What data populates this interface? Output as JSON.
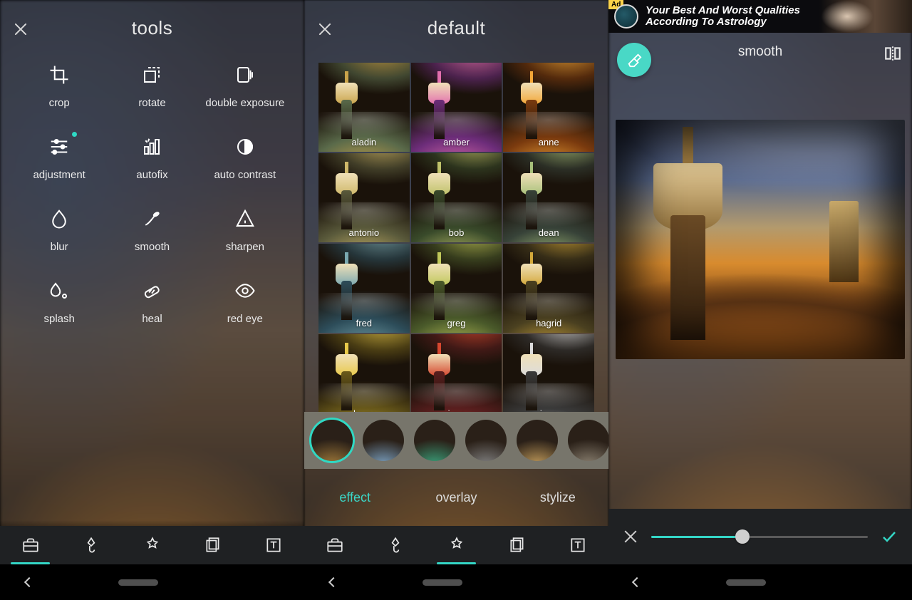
{
  "pane1": {
    "title": "tools",
    "tools": [
      {
        "label": "crop",
        "icon": "crop-icon",
        "dot": false
      },
      {
        "label": "rotate",
        "icon": "rotate-icon",
        "dot": false
      },
      {
        "label": "double exposure",
        "icon": "double-exposure-icon",
        "dot": false
      },
      {
        "label": "adjustment",
        "icon": "adjustment-icon",
        "dot": true
      },
      {
        "label": "autofix",
        "icon": "autofix-icon",
        "dot": false
      },
      {
        "label": "auto contrast",
        "icon": "auto-contrast-icon",
        "dot": false
      },
      {
        "label": "blur",
        "icon": "blur-icon",
        "dot": false
      },
      {
        "label": "smooth",
        "icon": "smooth-icon",
        "dot": false
      },
      {
        "label": "sharpen",
        "icon": "sharpen-icon",
        "dot": false
      },
      {
        "label": "splash",
        "icon": "splash-icon",
        "dot": false
      },
      {
        "label": "heal",
        "icon": "heal-icon",
        "dot": false
      },
      {
        "label": "red eye",
        "icon": "red-eye-icon",
        "dot": false
      }
    ],
    "bottom_tabs": [
      {
        "icon": "toolbox-icon",
        "active": true
      },
      {
        "icon": "brush-icon",
        "active": false
      },
      {
        "icon": "effects-icon",
        "active": false
      },
      {
        "icon": "layers-icon",
        "active": false
      },
      {
        "icon": "text-icon",
        "active": false
      }
    ]
  },
  "pane2": {
    "title": "default",
    "filters": [
      "aladin",
      "amber",
      "anne",
      "antonio",
      "bob",
      "dean",
      "fred",
      "greg",
      "hagrid",
      "harry",
      "ivan",
      "jean"
    ],
    "filter_tints": [
      {
        "a": "#5a6a4a",
        "b": "#c9a34a"
      },
      {
        "a": "#6d2d7a",
        "b": "#e36fae"
      },
      {
        "a": "#7a3a0e",
        "b": "#f3a637"
      },
      {
        "a": "#5a5a3b",
        "b": "#cfb86a"
      },
      {
        "a": "#394a2a",
        "b": "#bfc26a"
      },
      {
        "a": "#374238",
        "b": "#a7c07a"
      },
      {
        "a": "#2d4d5a",
        "b": "#7aa8b0"
      },
      {
        "a": "#4a5a2a",
        "b": "#c0c85a"
      },
      {
        "a": "#4a4020",
        "b": "#d3a83a"
      },
      {
        "a": "#6a5a1a",
        "b": "#e8c94a"
      },
      {
        "a": "#5a1e1e",
        "b": "#d5472f"
      },
      {
        "a": "#3a3a3a",
        "b": "#dcdcdc"
      }
    ],
    "category_tints": [
      "#a07a3a",
      "#7aa0c0",
      "#3aa07a",
      "#808080",
      "#c09a5a",
      "#8a8070",
      "#d040a0"
    ],
    "category_selected": 0,
    "modes": [
      {
        "label": "effect",
        "selected": true
      },
      {
        "label": "overlay",
        "selected": false
      },
      {
        "label": "stylize",
        "selected": false
      }
    ],
    "bottom_tabs": [
      {
        "icon": "toolbox-icon",
        "active": false
      },
      {
        "icon": "brush-icon",
        "active": false
      },
      {
        "icon": "effects-icon",
        "active": true
      },
      {
        "icon": "layers-icon",
        "active": false
      },
      {
        "icon": "text-icon",
        "active": false
      }
    ]
  },
  "pane3": {
    "ad": {
      "tag": "Ad",
      "text": "Your Best And Worst Qualities\nAccording To Astrology"
    },
    "title": "smooth",
    "slider_value": 0.42
  },
  "accent": "#34d6c6"
}
